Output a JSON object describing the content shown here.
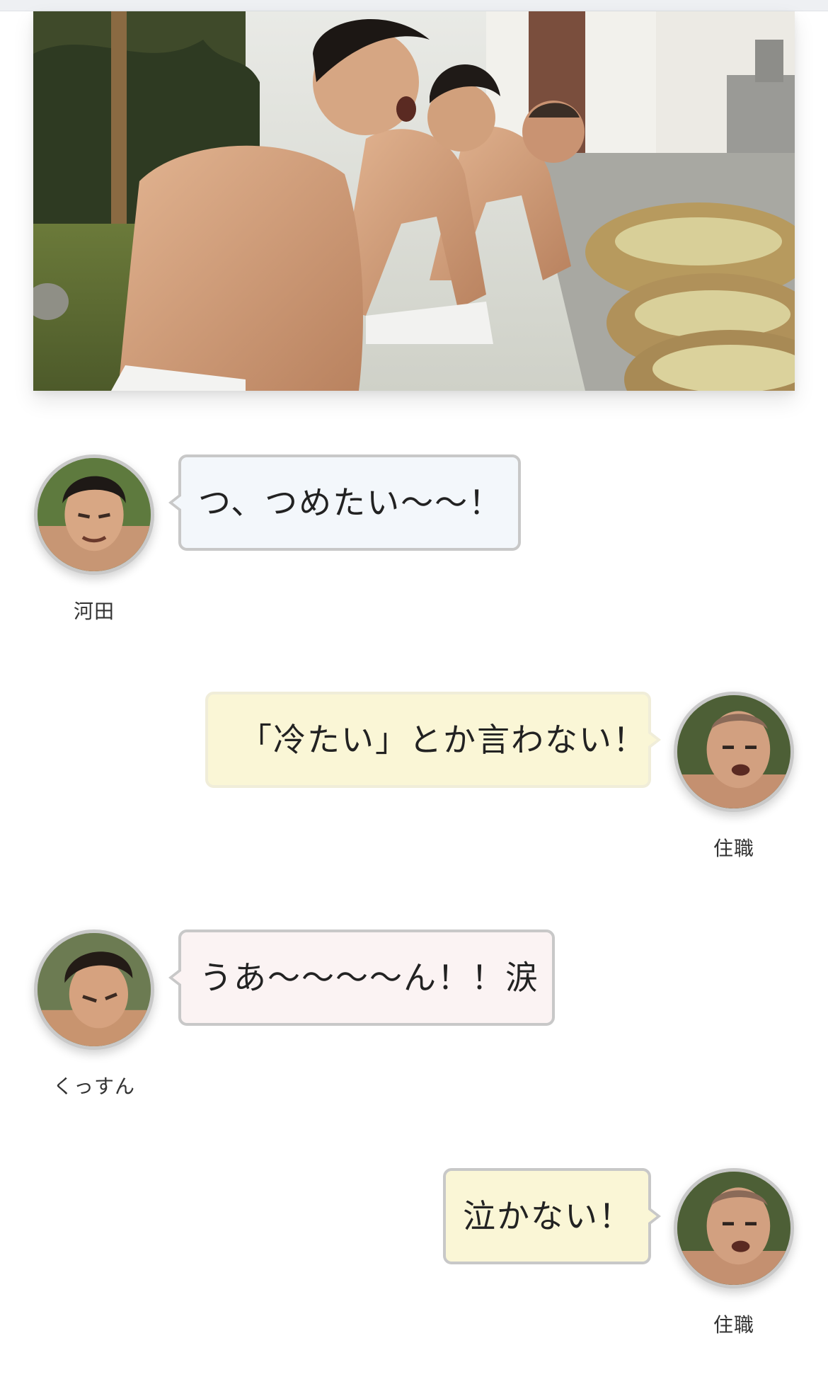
{
  "hero_image": {
    "alt_visual": "three shirtless men in loincloths beside straw-wrapped water tubs in a temple garden"
  },
  "dialogue": [
    {
      "speaker": "河田",
      "side": "left",
      "text": "つ、つめたい〜〜！",
      "bubble_color": "#f3f7fb"
    },
    {
      "speaker": "住職",
      "side": "right",
      "text": "「冷たい」とか言わない！",
      "bubble_color": "#faf6d6"
    },
    {
      "speaker": "くっすん",
      "side": "left",
      "text": "うあ〜〜〜〜ん！！涙",
      "bubble_color": "#fbf3f3"
    },
    {
      "speaker": "住職",
      "side": "right",
      "text": "泣かない！",
      "bubble_color": "#faf6d6"
    }
  ]
}
